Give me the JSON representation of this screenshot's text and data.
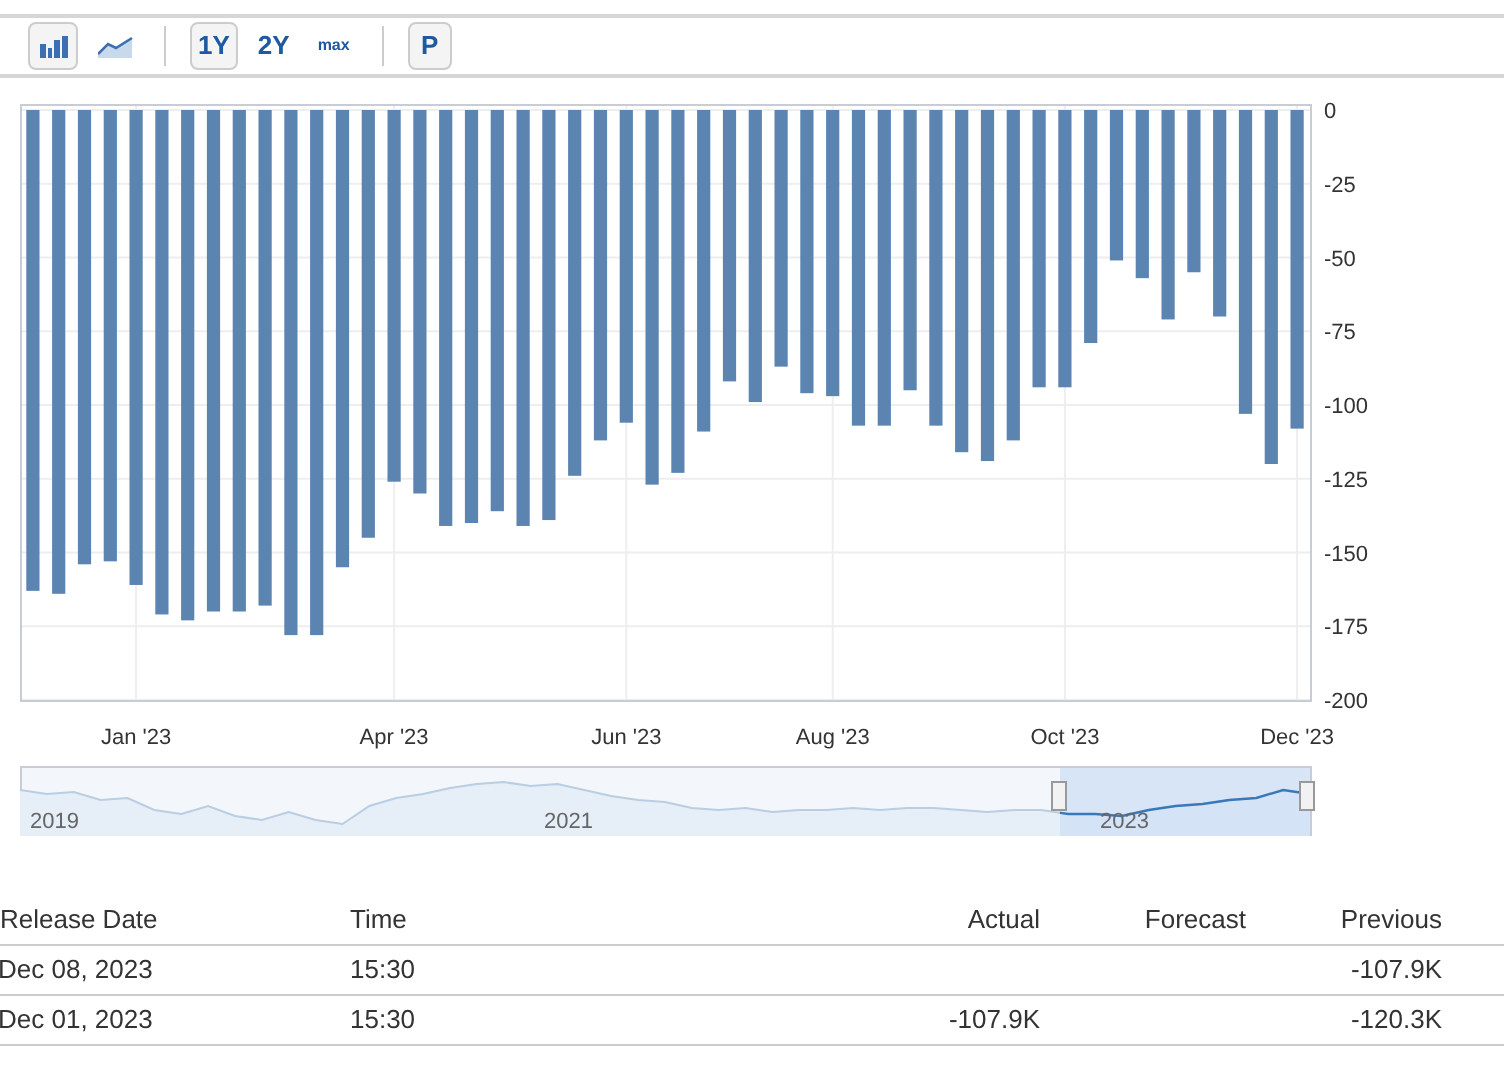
{
  "toolbar": {
    "chart_types": [
      {
        "kind": "bar",
        "selected": true
      },
      {
        "kind": "area",
        "selected": false
      }
    ],
    "ranges": [
      {
        "label": "1Y",
        "selected": true
      },
      {
        "label": "2Y",
        "selected": false
      },
      {
        "label": "max",
        "selected": false
      }
    ],
    "p_button": "P"
  },
  "chart": {
    "chart_data": {
      "type": "bar",
      "categories": [
        null,
        null,
        null,
        null,
        "Jan '23",
        null,
        null,
        null,
        null,
        null,
        null,
        null,
        null,
        null,
        "Apr '23",
        null,
        null,
        null,
        null,
        null,
        null,
        null,
        null,
        "Jun '23",
        null,
        null,
        null,
        null,
        null,
        null,
        null,
        "Aug '23",
        null,
        null,
        null,
        null,
        null,
        null,
        null,
        null,
        "Oct '23",
        null,
        null,
        null,
        null,
        null,
        null,
        null,
        null,
        "Dec '23"
      ],
      "series": [
        {
          "color": "#5b84b1",
          "values": [
            -163,
            -164,
            -154,
            -153,
            -161,
            -171,
            -173,
            -170,
            -170,
            -168,
            -178,
            -178,
            -155,
            -145,
            -126,
            -130,
            -141,
            -140,
            -136,
            -141,
            -139,
            -124,
            -112,
            -106,
            -127,
            -123,
            -109,
            -92,
            -99,
            -87,
            -96,
            -97,
            -107,
            -107,
            -95,
            -107,
            -116,
            -119,
            -112,
            -94,
            -94,
            -79,
            -51,
            -57,
            -71,
            -55,
            -70,
            -103,
            -120,
            -108
          ]
        }
      ],
      "ylim": [
        -200,
        0
      ],
      "grid": true,
      "yticks": [
        0,
        -25,
        -50,
        -75,
        -100,
        -125,
        -150,
        -175,
        -200
      ]
    }
  },
  "navigator": {
    "labels": [
      "2019",
      "2021",
      "2023"
    ]
  },
  "table": {
    "columns": [
      "Release Date",
      "Time",
      "Actual",
      "Forecast",
      "Previous"
    ],
    "rows": [
      [
        "Dec 08, 2023",
        "15:30",
        "",
        "",
        "-107.9K"
      ],
      [
        "Dec 01, 2023",
        "15:30",
        "-107.9K",
        "",
        "-120.3K"
      ]
    ]
  }
}
